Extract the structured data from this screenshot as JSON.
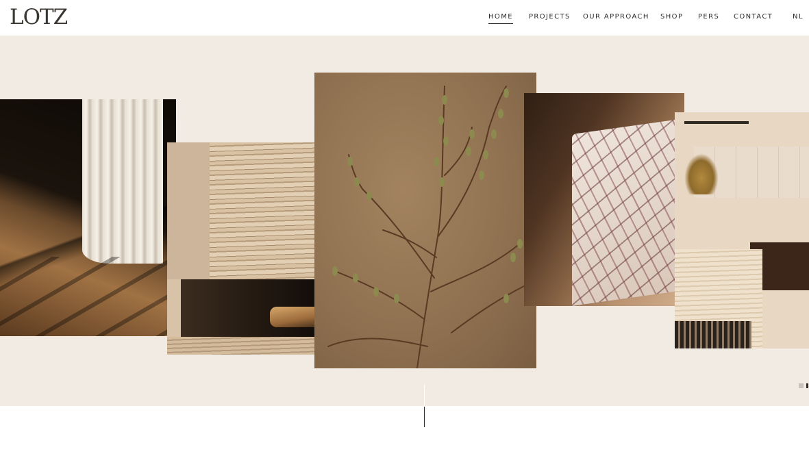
{
  "brand": {
    "logo_text": "LOTZ"
  },
  "nav": {
    "items": [
      {
        "label": "HOME",
        "active": true
      },
      {
        "label": "PROJECTS",
        "active": false
      },
      {
        "label": "OUR APPROACH",
        "active": false
      },
      {
        "label": "SHOP",
        "active": false
      },
      {
        "label": "PERS",
        "active": false
      },
      {
        "label": "CONTACT",
        "active": false
      }
    ],
    "language": "NL"
  },
  "hero": {
    "background_color": "#f1ebe4",
    "slides_total": 2,
    "active_slide": 2
  },
  "colors": {
    "text": "#2b2a28",
    "header_bg": "#ffffff"
  }
}
